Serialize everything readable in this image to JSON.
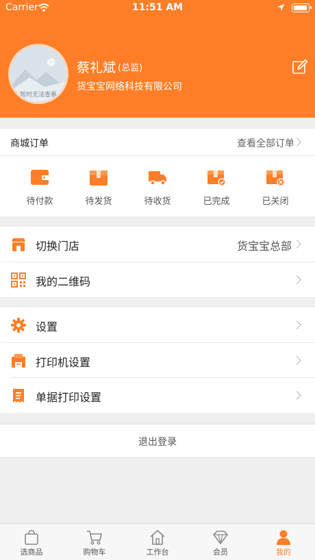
{
  "status_bar": {
    "carrier": "Carrier",
    "time": "11:51 AM"
  },
  "profile": {
    "name": "蔡礼斌",
    "role": "(总监)",
    "company": "货宝宝网络科技有限公司",
    "avatar_placeholder": "暂时无法查看"
  },
  "orders": {
    "title": "商城订单",
    "view_all": "查看全部订单",
    "items": [
      {
        "label": "待付款",
        "icon": "wallet-icon"
      },
      {
        "label": "待发货",
        "icon": "box-icon"
      },
      {
        "label": "待收货",
        "icon": "truck-icon"
      },
      {
        "label": "已完成",
        "icon": "box-check-icon"
      },
      {
        "label": "已关闭",
        "icon": "box-close-icon"
      }
    ]
  },
  "menu_group1": [
    {
      "label": "切换门店",
      "value": "货宝宝总部",
      "icon": "store-icon"
    },
    {
      "label": "我的二维码",
      "value": "",
      "icon": "qrcode-icon"
    }
  ],
  "menu_group2": [
    {
      "label": "设置",
      "icon": "gear-icon"
    },
    {
      "label": "打印机设置",
      "icon": "printer-icon"
    },
    {
      "label": "单据打印设置",
      "icon": "receipt-icon"
    }
  ],
  "logout": {
    "label": "退出登录"
  },
  "tabbar": {
    "items": [
      {
        "label": "选商品",
        "icon": "bag-icon"
      },
      {
        "label": "购物车",
        "icon": "cart-icon"
      },
      {
        "label": "工作台",
        "icon": "home-icon"
      },
      {
        "label": "会员",
        "icon": "diamond-icon"
      },
      {
        "label": "我的",
        "icon": "person-icon",
        "active": true
      }
    ]
  },
  "colors": {
    "accent": "#ff7e27",
    "background": "#efefef"
  }
}
